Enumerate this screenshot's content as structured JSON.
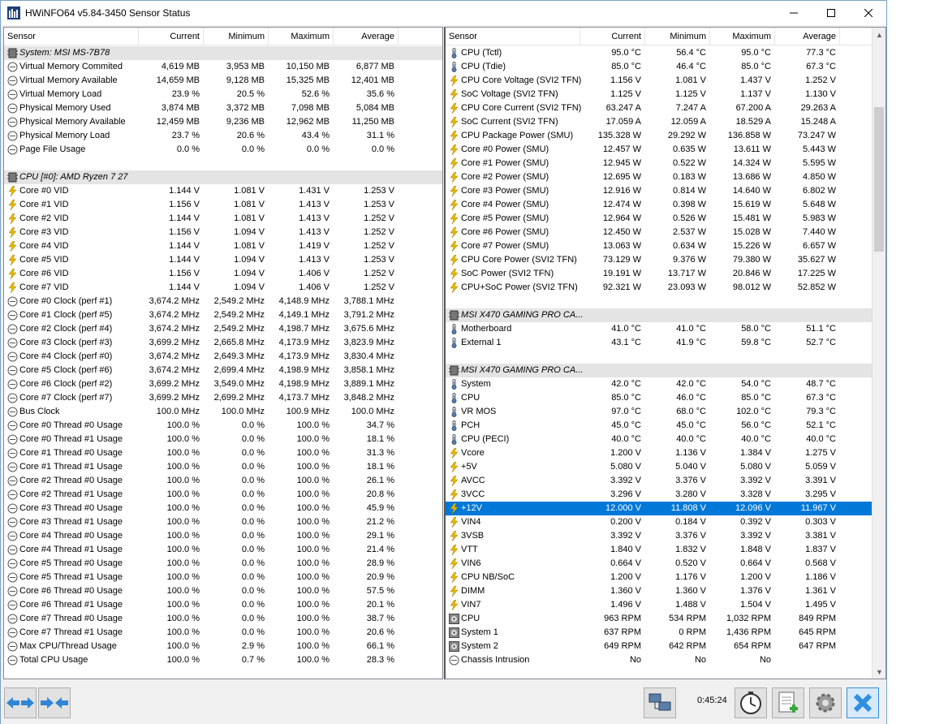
{
  "window": {
    "title": "HWiNFO64 v5.84-3450 Sensor Status"
  },
  "columns": {
    "sensor": "Sensor",
    "current": "Current",
    "minimum": "Minimum",
    "maximum": "Maximum",
    "average": "Average"
  },
  "left_rows": [
    {
      "type": "group",
      "icon": "chip",
      "name": "System: MSI MS-7B78"
    },
    {
      "type": "row",
      "icon": "gauge",
      "name": "Virtual Memory Commited",
      "cur": "4,619 MB",
      "min": "3,953 MB",
      "max": "10,150 MB",
      "avg": "6,877 MB"
    },
    {
      "type": "row",
      "icon": "gauge",
      "name": "Virtual Memory Available",
      "cur": "14,659 MB",
      "min": "9,128 MB",
      "max": "15,325 MB",
      "avg": "12,401 MB"
    },
    {
      "type": "row",
      "icon": "gauge",
      "name": "Virtual Memory Load",
      "cur": "23.9 %",
      "min": "20.5 %",
      "max": "52.6 %",
      "avg": "35.6 %"
    },
    {
      "type": "row",
      "icon": "gauge",
      "name": "Physical Memory Used",
      "cur": "3,874 MB",
      "min": "3,372 MB",
      "max": "7,098 MB",
      "avg": "5,084 MB"
    },
    {
      "type": "row",
      "icon": "gauge",
      "name": "Physical Memory Available",
      "cur": "12,459 MB",
      "min": "9,236 MB",
      "max": "12,962 MB",
      "avg": "11,250 MB"
    },
    {
      "type": "row",
      "icon": "gauge",
      "name": "Physical Memory Load",
      "cur": "23.7 %",
      "min": "20.6 %",
      "max": "43.4 %",
      "avg": "31.1 %"
    },
    {
      "type": "row",
      "icon": "gauge",
      "name": "Page File Usage",
      "cur": "0.0 %",
      "min": "0.0 %",
      "max": "0.0 %",
      "avg": "0.0 %"
    },
    {
      "type": "blank"
    },
    {
      "type": "group",
      "icon": "chip",
      "name": "CPU [#0]: AMD Ryzen 7 27"
    },
    {
      "type": "row",
      "icon": "bolt",
      "name": "Core #0 VID",
      "cur": "1.144 V",
      "min": "1.081 V",
      "max": "1.431 V",
      "avg": "1.253 V"
    },
    {
      "type": "row",
      "icon": "bolt",
      "name": "Core #1 VID",
      "cur": "1.156 V",
      "min": "1.081 V",
      "max": "1.413 V",
      "avg": "1.253 V"
    },
    {
      "type": "row",
      "icon": "bolt",
      "name": "Core #2 VID",
      "cur": "1.144 V",
      "min": "1.081 V",
      "max": "1.413 V",
      "avg": "1.252 V"
    },
    {
      "type": "row",
      "icon": "bolt",
      "name": "Core #3 VID",
      "cur": "1.156 V",
      "min": "1.094 V",
      "max": "1.413 V",
      "avg": "1.252 V"
    },
    {
      "type": "row",
      "icon": "bolt",
      "name": "Core #4 VID",
      "cur": "1.144 V",
      "min": "1.081 V",
      "max": "1.419 V",
      "avg": "1.252 V"
    },
    {
      "type": "row",
      "icon": "bolt",
      "name": "Core #5 VID",
      "cur": "1.144 V",
      "min": "1.094 V",
      "max": "1.413 V",
      "avg": "1.253 V"
    },
    {
      "type": "row",
      "icon": "bolt",
      "name": "Core #6 VID",
      "cur": "1.156 V",
      "min": "1.094 V",
      "max": "1.406 V",
      "avg": "1.252 V"
    },
    {
      "type": "row",
      "icon": "bolt",
      "name": "Core #7 VID",
      "cur": "1.144 V",
      "min": "1.094 V",
      "max": "1.406 V",
      "avg": "1.252 V"
    },
    {
      "type": "row",
      "icon": "gauge",
      "name": "Core #0 Clock (perf #1)",
      "cur": "3,674.2 MHz",
      "min": "2,549.2 MHz",
      "max": "4,148.9 MHz",
      "avg": "3,788.1 MHz"
    },
    {
      "type": "row",
      "icon": "gauge",
      "name": "Core #1 Clock (perf #5)",
      "cur": "3,674.2 MHz",
      "min": "2,549.2 MHz",
      "max": "4,149.1 MHz",
      "avg": "3,791.2 MHz"
    },
    {
      "type": "row",
      "icon": "gauge",
      "name": "Core #2 Clock (perf #4)",
      "cur": "3,674.2 MHz",
      "min": "2,549.2 MHz",
      "max": "4,198.7 MHz",
      "avg": "3,675.6 MHz"
    },
    {
      "type": "row",
      "icon": "gauge",
      "name": "Core #3 Clock (perf #3)",
      "cur": "3,699.2 MHz",
      "min": "2,665.8 MHz",
      "max": "4,173.9 MHz",
      "avg": "3,823.9 MHz"
    },
    {
      "type": "row",
      "icon": "gauge",
      "name": "Core #4 Clock (perf #0)",
      "cur": "3,674.2 MHz",
      "min": "2,649.3 MHz",
      "max": "4,173.9 MHz",
      "avg": "3,830.4 MHz"
    },
    {
      "type": "row",
      "icon": "gauge",
      "name": "Core #5 Clock (perf #6)",
      "cur": "3,674.2 MHz",
      "min": "2,699.4 MHz",
      "max": "4,198.9 MHz",
      "avg": "3,858.1 MHz"
    },
    {
      "type": "row",
      "icon": "gauge",
      "name": "Core #6 Clock (perf #2)",
      "cur": "3,699.2 MHz",
      "min": "3,549.0 MHz",
      "max": "4,198.9 MHz",
      "avg": "3,889.1 MHz"
    },
    {
      "type": "row",
      "icon": "gauge",
      "name": "Core #7 Clock (perf #7)",
      "cur": "3,699.2 MHz",
      "min": "2,699.2 MHz",
      "max": "4,173.7 MHz",
      "avg": "3,848.2 MHz"
    },
    {
      "type": "row",
      "icon": "gauge",
      "name": "Bus Clock",
      "cur": "100.0 MHz",
      "min": "100.0 MHz",
      "max": "100.9 MHz",
      "avg": "100.0 MHz"
    },
    {
      "type": "row",
      "icon": "gauge",
      "name": "Core #0 Thread #0 Usage",
      "cur": "100.0 %",
      "min": "0.0 %",
      "max": "100.0 %",
      "avg": "34.7 %"
    },
    {
      "type": "row",
      "icon": "gauge",
      "name": "Core #0 Thread #1 Usage",
      "cur": "100.0 %",
      "min": "0.0 %",
      "max": "100.0 %",
      "avg": "18.1 %"
    },
    {
      "type": "row",
      "icon": "gauge",
      "name": "Core #1 Thread #0 Usage",
      "cur": "100.0 %",
      "min": "0.0 %",
      "max": "100.0 %",
      "avg": "31.3 %"
    },
    {
      "type": "row",
      "icon": "gauge",
      "name": "Core #1 Thread #1 Usage",
      "cur": "100.0 %",
      "min": "0.0 %",
      "max": "100.0 %",
      "avg": "18.1 %"
    },
    {
      "type": "row",
      "icon": "gauge",
      "name": "Core #2 Thread #0 Usage",
      "cur": "100.0 %",
      "min": "0.0 %",
      "max": "100.0 %",
      "avg": "26.1 %"
    },
    {
      "type": "row",
      "icon": "gauge",
      "name": "Core #2 Thread #1 Usage",
      "cur": "100.0 %",
      "min": "0.0 %",
      "max": "100.0 %",
      "avg": "20.8 %"
    },
    {
      "type": "row",
      "icon": "gauge",
      "name": "Core #3 Thread #0 Usage",
      "cur": "100.0 %",
      "min": "0.0 %",
      "max": "100.0 %",
      "avg": "45.9 %"
    },
    {
      "type": "row",
      "icon": "gauge",
      "name": "Core #3 Thread #1 Usage",
      "cur": "100.0 %",
      "min": "0.0 %",
      "max": "100.0 %",
      "avg": "21.2 %"
    },
    {
      "type": "row",
      "icon": "gauge",
      "name": "Core #4 Thread #0 Usage",
      "cur": "100.0 %",
      "min": "0.0 %",
      "max": "100.0 %",
      "avg": "29.1 %"
    },
    {
      "type": "row",
      "icon": "gauge",
      "name": "Core #4 Thread #1 Usage",
      "cur": "100.0 %",
      "min": "0.0 %",
      "max": "100.0 %",
      "avg": "21.4 %"
    },
    {
      "type": "row",
      "icon": "gauge",
      "name": "Core #5 Thread #0 Usage",
      "cur": "100.0 %",
      "min": "0.0 %",
      "max": "100.0 %",
      "avg": "28.9 %"
    },
    {
      "type": "row",
      "icon": "gauge",
      "name": "Core #5 Thread #1 Usage",
      "cur": "100.0 %",
      "min": "0.0 %",
      "max": "100.0 %",
      "avg": "20.9 %"
    },
    {
      "type": "row",
      "icon": "gauge",
      "name": "Core #6 Thread #0 Usage",
      "cur": "100.0 %",
      "min": "0.0 %",
      "max": "100.0 %",
      "avg": "57.5 %"
    },
    {
      "type": "row",
      "icon": "gauge",
      "name": "Core #6 Thread #1 Usage",
      "cur": "100.0 %",
      "min": "0.0 %",
      "max": "100.0 %",
      "avg": "20.1 %"
    },
    {
      "type": "row",
      "icon": "gauge",
      "name": "Core #7 Thread #0 Usage",
      "cur": "100.0 %",
      "min": "0.0 %",
      "max": "100.0 %",
      "avg": "38.7 %"
    },
    {
      "type": "row",
      "icon": "gauge",
      "name": "Core #7 Thread #1 Usage",
      "cur": "100.0 %",
      "min": "0.0 %",
      "max": "100.0 %",
      "avg": "20.6 %"
    },
    {
      "type": "row",
      "icon": "gauge",
      "name": "Max CPU/Thread Usage",
      "cur": "100.0 %",
      "min": "2.9 %",
      "max": "100.0 %",
      "avg": "66.1 %"
    },
    {
      "type": "row",
      "icon": "gauge",
      "name": "Total CPU Usage",
      "cur": "100.0 %",
      "min": "0.7 %",
      "max": "100.0 %",
      "avg": "28.3 %"
    }
  ],
  "right_rows": [
    {
      "type": "row",
      "icon": "thermo",
      "name": "CPU (Tctl)",
      "cur": "95.0 °C",
      "min": "56.4 °C",
      "max": "95.0 °C",
      "avg": "77.3 °C"
    },
    {
      "type": "row",
      "icon": "thermo",
      "name": "CPU (Tdie)",
      "cur": "85.0 °C",
      "min": "46.4 °C",
      "max": "85.0 °C",
      "avg": "67.3 °C"
    },
    {
      "type": "row",
      "icon": "bolt",
      "name": "CPU Core Voltage (SVI2 TFN)",
      "cur": "1.156 V",
      "min": "1.081 V",
      "max": "1.437 V",
      "avg": "1.252 V"
    },
    {
      "type": "row",
      "icon": "bolt",
      "name": "SoC Voltage (SVI2 TFN)",
      "cur": "1.125 V",
      "min": "1.125 V",
      "max": "1.137 V",
      "avg": "1.130 V"
    },
    {
      "type": "row",
      "icon": "bolt",
      "name": "CPU Core Current (SVI2 TFN)",
      "cur": "63.247 A",
      "min": "7.247 A",
      "max": "67.200 A",
      "avg": "29.263 A"
    },
    {
      "type": "row",
      "icon": "bolt",
      "name": "SoC Current (SVI2 TFN)",
      "cur": "17.059 A",
      "min": "12.059 A",
      "max": "18.529 A",
      "avg": "15.248 A"
    },
    {
      "type": "row",
      "icon": "bolt",
      "name": "CPU Package Power (SMU)",
      "cur": "135.328 W",
      "min": "29.292 W",
      "max": "136.858 W",
      "avg": "73.247 W"
    },
    {
      "type": "row",
      "icon": "bolt",
      "name": "Core #0 Power (SMU)",
      "cur": "12.457 W",
      "min": "0.635 W",
      "max": "13.611 W",
      "avg": "5.443 W"
    },
    {
      "type": "row",
      "icon": "bolt",
      "name": "Core #1 Power (SMU)",
      "cur": "12.945 W",
      "min": "0.522 W",
      "max": "14.324 W",
      "avg": "5.595 W"
    },
    {
      "type": "row",
      "icon": "bolt",
      "name": "Core #2 Power (SMU)",
      "cur": "12.695 W",
      "min": "0.183 W",
      "max": "13.686 W",
      "avg": "4.850 W"
    },
    {
      "type": "row",
      "icon": "bolt",
      "name": "Core #3 Power (SMU)",
      "cur": "12.916 W",
      "min": "0.814 W",
      "max": "14.640 W",
      "avg": "6.802 W"
    },
    {
      "type": "row",
      "icon": "bolt",
      "name": "Core #4 Power (SMU)",
      "cur": "12.474 W",
      "min": "0.398 W",
      "max": "15.619 W",
      "avg": "5.648 W"
    },
    {
      "type": "row",
      "icon": "bolt",
      "name": "Core #5 Power (SMU)",
      "cur": "12.964 W",
      "min": "0.526 W",
      "max": "15.481 W",
      "avg": "5.983 W"
    },
    {
      "type": "row",
      "icon": "bolt",
      "name": "Core #6 Power (SMU)",
      "cur": "12.450 W",
      "min": "2.537 W",
      "max": "15.028 W",
      "avg": "7.440 W"
    },
    {
      "type": "row",
      "icon": "bolt",
      "name": "Core #7 Power (SMU)",
      "cur": "13.063 W",
      "min": "0.634 W",
      "max": "15.226 W",
      "avg": "6.657 W"
    },
    {
      "type": "row",
      "icon": "bolt",
      "name": "CPU Core Power (SVI2 TFN)",
      "cur": "73.129 W",
      "min": "9.376 W",
      "max": "79.380 W",
      "avg": "35.627 W"
    },
    {
      "type": "row",
      "icon": "bolt",
      "name": "SoC Power (SVI2 TFN)",
      "cur": "19.191 W",
      "min": "13.717 W",
      "max": "20.846 W",
      "avg": "17.225 W"
    },
    {
      "type": "row",
      "icon": "bolt",
      "name": "CPU+SoC Power (SVI2 TFN)",
      "cur": "92.321 W",
      "min": "23.093 W",
      "max": "98.012 W",
      "avg": "52.852 W"
    },
    {
      "type": "blank"
    },
    {
      "type": "group",
      "icon": "chip",
      "name": "MSI X470 GAMING PRO CA..."
    },
    {
      "type": "row",
      "icon": "thermo",
      "name": "Motherboard",
      "cur": "41.0 °C",
      "min": "41.0 °C",
      "max": "58.0 °C",
      "avg": "51.1 °C"
    },
    {
      "type": "row",
      "icon": "thermo",
      "name": "External 1",
      "cur": "43.1 °C",
      "min": "41.9 °C",
      "max": "59.8 °C",
      "avg": "52.7 °C"
    },
    {
      "type": "blank"
    },
    {
      "type": "group",
      "icon": "chip",
      "name": "MSI X470 GAMING PRO CA..."
    },
    {
      "type": "row",
      "icon": "thermo",
      "name": "System",
      "cur": "42.0 °C",
      "min": "42.0 °C",
      "max": "54.0 °C",
      "avg": "48.7 °C"
    },
    {
      "type": "row",
      "icon": "thermo",
      "name": "CPU",
      "cur": "85.0 °C",
      "min": "46.0 °C",
      "max": "85.0 °C",
      "avg": "67.3 °C"
    },
    {
      "type": "row",
      "icon": "thermo",
      "name": "VR MOS",
      "cur": "97.0 °C",
      "min": "68.0 °C",
      "max": "102.0 °C",
      "avg": "79.3 °C"
    },
    {
      "type": "row",
      "icon": "thermo",
      "name": "PCH",
      "cur": "45.0 °C",
      "min": "45.0 °C",
      "max": "56.0 °C",
      "avg": "52.1 °C"
    },
    {
      "type": "row",
      "icon": "thermo",
      "name": "CPU (PECI)",
      "cur": "40.0 °C",
      "min": "40.0 °C",
      "max": "40.0 °C",
      "avg": "40.0 °C"
    },
    {
      "type": "row",
      "icon": "bolt",
      "name": "Vcore",
      "cur": "1.200 V",
      "min": "1.136 V",
      "max": "1.384 V",
      "avg": "1.275 V"
    },
    {
      "type": "row",
      "icon": "bolt",
      "name": "+5V",
      "cur": "5.080 V",
      "min": "5.040 V",
      "max": "5.080 V",
      "avg": "5.059 V"
    },
    {
      "type": "row",
      "icon": "bolt",
      "name": "AVCC",
      "cur": "3.392 V",
      "min": "3.376 V",
      "max": "3.392 V",
      "avg": "3.391 V"
    },
    {
      "type": "row",
      "icon": "bolt",
      "name": "3VCC",
      "cur": "3.296 V",
      "min": "3.280 V",
      "max": "3.328 V",
      "avg": "3.295 V"
    },
    {
      "type": "row",
      "icon": "bolt",
      "name": "+12V",
      "cur": "12.000 V",
      "min": "11.808 V",
      "max": "12.096 V",
      "avg": "11.967 V",
      "selected": true
    },
    {
      "type": "row",
      "icon": "bolt",
      "name": "VIN4",
      "cur": "0.200 V",
      "min": "0.184 V",
      "max": "0.392 V",
      "avg": "0.303 V"
    },
    {
      "type": "row",
      "icon": "bolt",
      "name": "3VSB",
      "cur": "3.392 V",
      "min": "3.376 V",
      "max": "3.392 V",
      "avg": "3.381 V"
    },
    {
      "type": "row",
      "icon": "bolt",
      "name": "VTT",
      "cur": "1.840 V",
      "min": "1.832 V",
      "max": "1.848 V",
      "avg": "1.837 V"
    },
    {
      "type": "row",
      "icon": "bolt",
      "name": "VIN6",
      "cur": "0.664 V",
      "min": "0.520 V",
      "max": "0.664 V",
      "avg": "0.568 V"
    },
    {
      "type": "row",
      "icon": "bolt",
      "name": "CPU NB/SoC",
      "cur": "1.200 V",
      "min": "1.176 V",
      "max": "1.200 V",
      "avg": "1.186 V"
    },
    {
      "type": "row",
      "icon": "bolt",
      "name": "DIMM",
      "cur": "1.360 V",
      "min": "1.360 V",
      "max": "1.376 V",
      "avg": "1.361 V"
    },
    {
      "type": "row",
      "icon": "bolt",
      "name": "VIN7",
      "cur": "1.496 V",
      "min": "1.488 V",
      "max": "1.504 V",
      "avg": "1.495 V"
    },
    {
      "type": "row",
      "icon": "fan",
      "name": "CPU",
      "cur": "963 RPM",
      "min": "534 RPM",
      "max": "1,032 RPM",
      "avg": "849 RPM"
    },
    {
      "type": "row",
      "icon": "fan",
      "name": "System 1",
      "cur": "637 RPM",
      "min": "0 RPM",
      "max": "1,436 RPM",
      "avg": "645 RPM"
    },
    {
      "type": "row",
      "icon": "fan",
      "name": "System 2",
      "cur": "649 RPM",
      "min": "642 RPM",
      "max": "654 RPM",
      "avg": "647 RPM"
    },
    {
      "type": "row",
      "icon": "gauge",
      "name": "Chassis Intrusion",
      "cur": "No",
      "min": "No",
      "max": "No",
      "avg": ""
    }
  ],
  "toolbar": {
    "timer": "0:45:24"
  },
  "colors": {
    "selection": "#0078d7",
    "group_bg": "#e4e4e4",
    "bolt": "#e8b800",
    "thermo": "#4a7fc4",
    "close_btn": "#2f8fe0"
  }
}
